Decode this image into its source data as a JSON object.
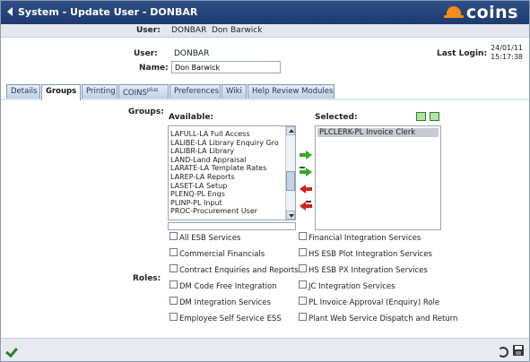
{
  "window": {
    "title": "System - Update User - DONBAR",
    "logo_text": "coins"
  },
  "userbar": {
    "label": "User:",
    "code": "DONBAR",
    "name": "Don Barwick"
  },
  "info": {
    "user_label": "User:",
    "user_value": "DONBAR",
    "name_label": "Name:",
    "name_value": "Don Barwick",
    "last_login_label": "Last Login:",
    "last_login_date": "24/01/11",
    "last_login_time": "15:17:38"
  },
  "tabs": [
    {
      "label": "Details"
    },
    {
      "label": "Groups",
      "active": true
    },
    {
      "label": "Printing"
    },
    {
      "label": "COINS",
      "sup": "plus"
    },
    {
      "label": "Preferences"
    },
    {
      "label": "Wiki"
    },
    {
      "label": "Help Review Modules"
    }
  ],
  "groups": {
    "label": "Groups:",
    "available_label": "Available:",
    "selected_label": "Selected:",
    "available": [
      "LAFULL-LA Full Access",
      "LALIBE-LA Library Enquiry Gro",
      "LALIBR-LA Library",
      "LAND-Land Appraisal",
      "LARATE-LA Template Rates",
      "LAREP-LA Reports",
      "LASET-LA Setup",
      "PLENQ-PL Enqs",
      "PLINP-PL Input",
      "PROC-Procurement User"
    ],
    "selected": [
      "PLCLERK-PL Invoice Clerk"
    ]
  },
  "roles": {
    "label": "Roles:",
    "left": [
      "All ESB Services",
      "Commercial Financials",
      "Contract Enquiries and Reports",
      "DM Code Free Integration",
      "DM Integration Services",
      "Employee Self Service ESS"
    ],
    "right": [
      "Financial Integration Services",
      "HS ESB Plot Integration Services",
      "HS ESB PX Integration Services",
      "JC Integration Services",
      "PL Invoice Approval (Enquiry) Role",
      "Plant Web Service Dispatch and Return"
    ]
  },
  "colors": {
    "titlebar": "#1d3a6e",
    "accent": "#f28c1b",
    "add": "#3aa62c",
    "remove": "#d22020"
  }
}
